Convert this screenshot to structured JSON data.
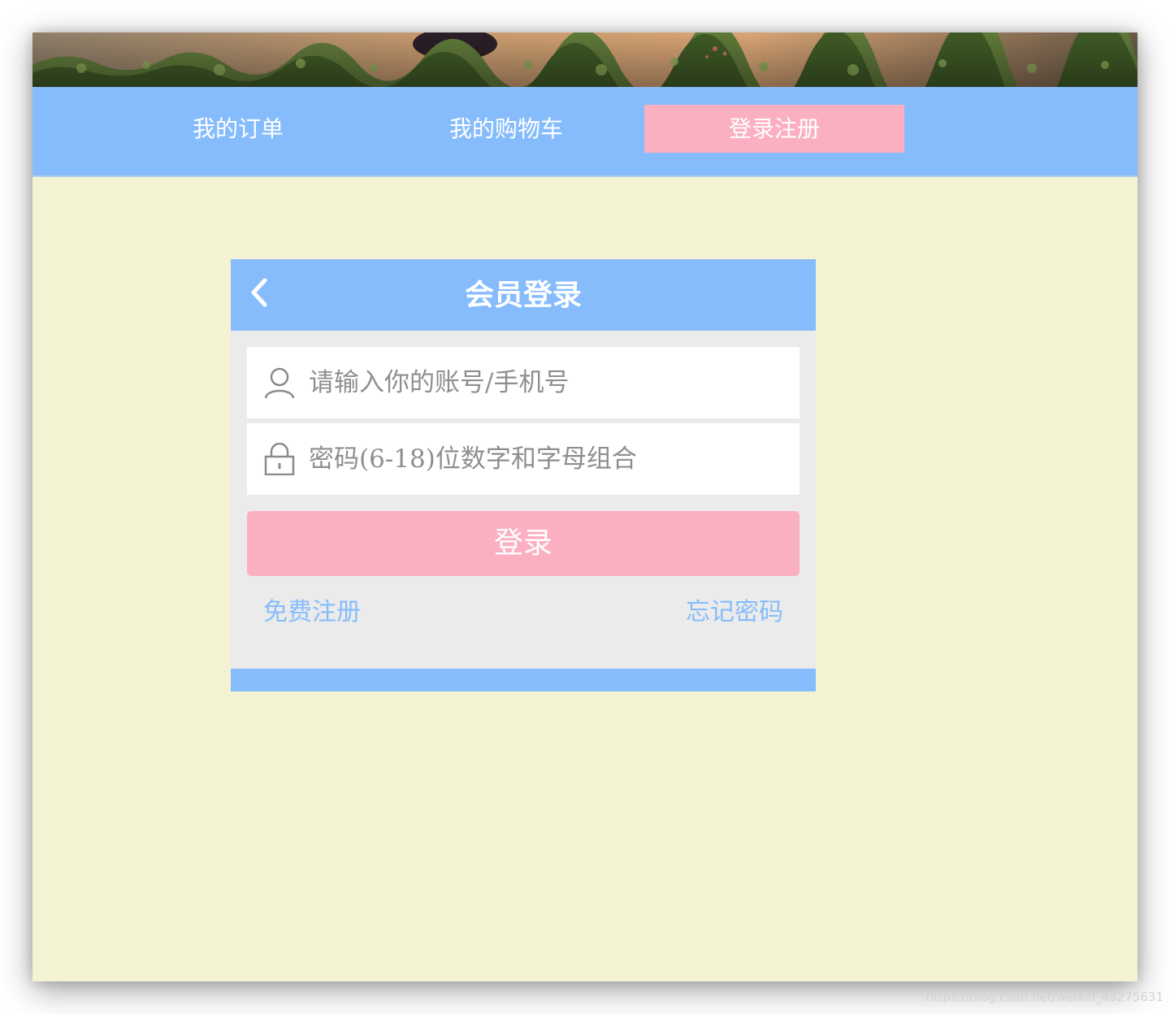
{
  "nav": {
    "items": [
      {
        "label": "我的订单"
      },
      {
        "label": "我的购物车"
      },
      {
        "label": "登录注册",
        "active": true
      }
    ]
  },
  "login": {
    "title": "会员登录",
    "username_placeholder": "请输入你的账号/手机号",
    "password_placeholder": "密码(6-18)位数字和字母组合",
    "submit_label": "登录",
    "register_link": "免费注册",
    "forgot_link": "忘记密码"
  },
  "icons": {
    "back": "chevron-left-icon",
    "user": "user-icon",
    "lock": "lock-icon"
  },
  "colors": {
    "primary_blue": "#86bcfc",
    "accent_pink": "#fbb0c2",
    "page_background": "#f3f3d4",
    "card_background": "#ebebeb"
  },
  "watermark": "https://blog.csdn.net/weixin_43275631"
}
